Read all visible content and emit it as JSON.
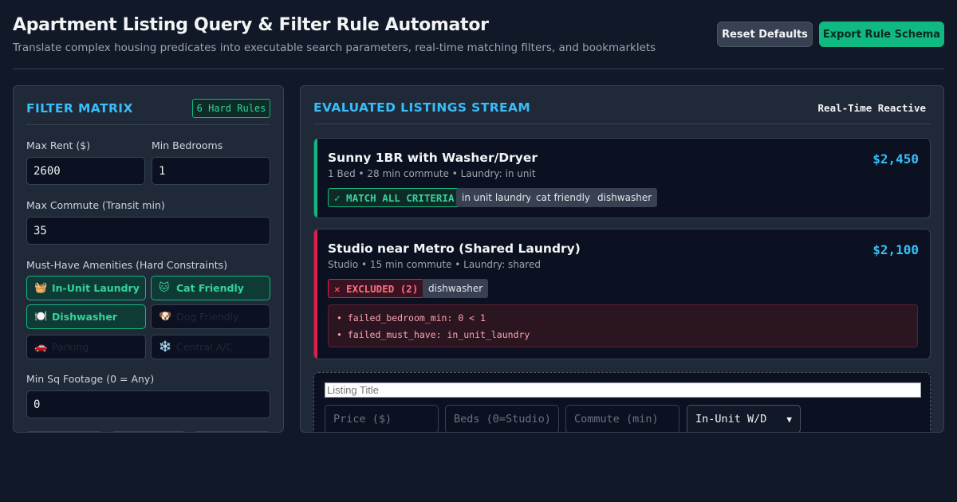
{
  "header": {
    "title": "Apartment Listing Query & Filter Rule Automator",
    "subtitle": "Translate complex housing predicates into executable search parameters, real-time matching filters, and bookmarklets",
    "reset_label": "Reset Defaults",
    "export_label": "Export Rule Schema"
  },
  "filters": {
    "heading": "FILTER MATRIX",
    "badge": "6 Hard Rules",
    "max_rent_label": "Max Rent ($)",
    "max_rent_value": "2600",
    "min_beds_label": "Min Bedrooms",
    "min_beds_value": "1",
    "max_commute_label": "Max Commute (Transit min)",
    "max_commute_value": "35",
    "amenities_label": "Must-Have Amenities (Hard Constraints)",
    "amenities": [
      {
        "label": "In-Unit Laundry",
        "icon": "laundry-basket-icon",
        "glyph": "🧺",
        "active": true
      },
      {
        "label": "Cat Friendly",
        "icon": "cat-icon",
        "glyph": "🐱",
        "active": true
      },
      {
        "label": "Dishwasher",
        "icon": "plate-icon",
        "glyph": "🍽️",
        "active": true
      },
      {
        "label": "Dog Friendly",
        "icon": "dog-icon",
        "glyph": "🐶",
        "active": false
      },
      {
        "label": "Parking",
        "icon": "car-icon",
        "glyph": "🚗",
        "active": false
      },
      {
        "label": "Central A/C",
        "icon": "snowflake-icon",
        "glyph": "❄️",
        "active": false
      }
    ],
    "min_sqft_label": "Min Sq Footage (0 = Any)",
    "min_sqft_value": "0"
  },
  "stream": {
    "heading": "EVALUATED LISTINGS STREAM",
    "mode": "Real-Time Reactive",
    "listings": [
      {
        "title": "Sunny 1BR with Washer/Dryer",
        "meta": "1 Bed • 28 min commute • Laundry: in unit",
        "price": "$2,450",
        "status": "✓ MATCH ALL CRITERIA",
        "tags": [
          "in unit laundry",
          "cat friendly",
          "dishwasher"
        ]
      },
      {
        "title": "Studio near Metro (Shared Laundry)",
        "meta": "Studio • 15 min commute • Laundry: shared",
        "price": "$2,100",
        "status": "✕ EXCLUDED (2)",
        "tags": [
          "dishwasher"
        ],
        "failures": [
          "failed_bedroom_min: 0 < 1",
          "failed_must_have: in_unit_laundry"
        ]
      }
    ]
  },
  "composer": {
    "title_placeholder": "Listing Title",
    "price_placeholder": "Price ($)",
    "beds_placeholder": "Beds (0=Studio)",
    "commute_placeholder": "Commute (min)",
    "laundry_selected": "In-Unit W/D"
  },
  "colors": {
    "background": "#111827",
    "panel": "#1f2937",
    "accent": "#38bdf8",
    "success": "#10b981",
    "danger": "#e11d48"
  }
}
